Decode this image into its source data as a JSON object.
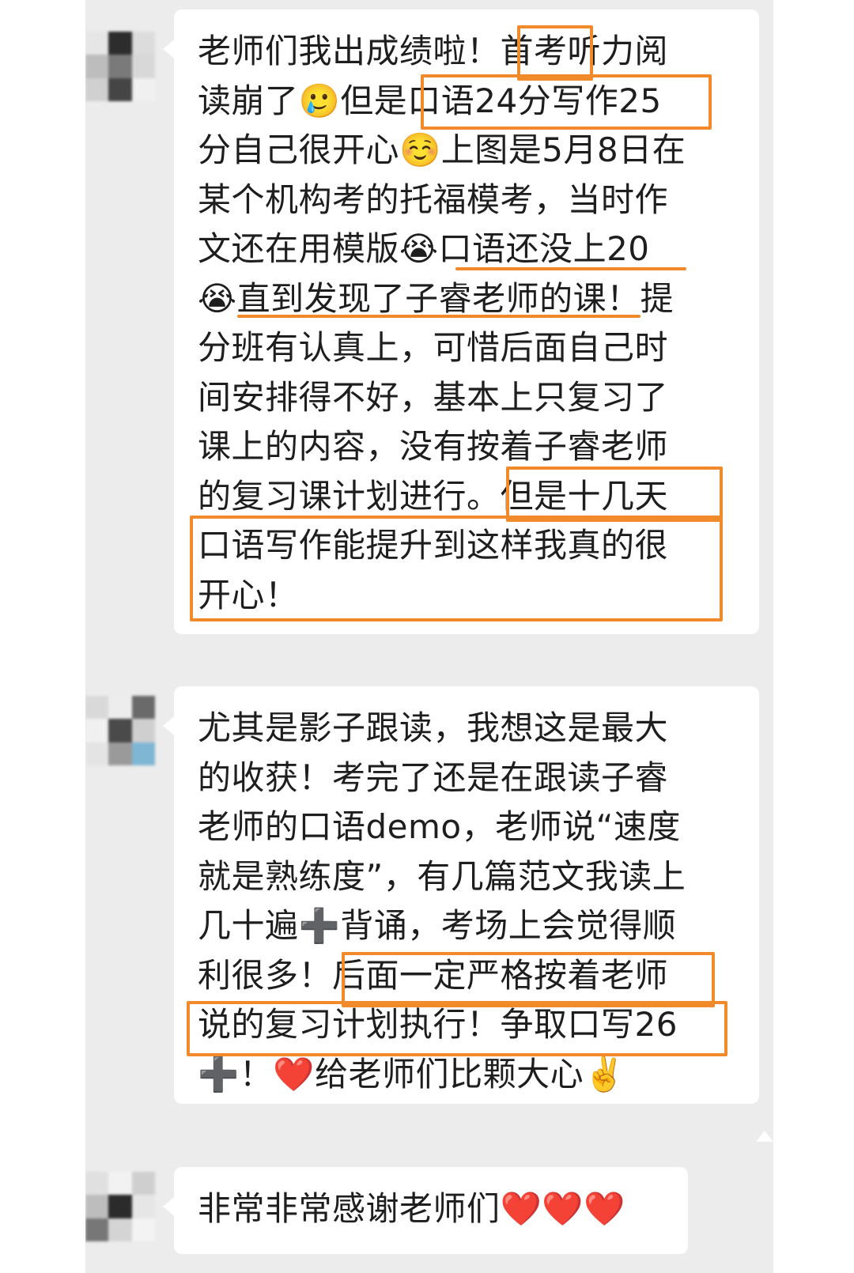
{
  "messages": [
    {
      "text": "老师们我出成绩啦！首考听力阅\n读崩了🥲但是口语24分写作25\n分自己很开心☺️上图是5月8日在\n某个机构考的托福模考，当时作\n文还在用模版😭口语还没上20\n😭直到发现了子睿老师的课！提\n分班有认真上，可惜后面自己时\n间安排得不好，基本上只复习了\n课上的内容，没有按着子睿老师\n的复习课计划进行。但是十几天\n口语写作能提升到这样我真的很\n开心！"
    },
    {
      "text": "尤其是影子跟读，我想这是最大\n的收获！考完了还是在跟读子睿\n老师的口语demo，老师说“速度\n就是熟练度”，有几篇范文我读上\n几十遍➕背诵，考场上会觉得顺\n利很多！后面一定严格按着老师\n说的复习计划执行！争取口写26\n➕！❤️给老师们比颗大心✌️"
    },
    {
      "text": "非常非常感谢老师们❤️❤️❤️"
    }
  ],
  "colors": {
    "highlight": "#f08a2a",
    "background": "#ececec",
    "bubble": "#ffffff",
    "heart": "#f0587a"
  }
}
